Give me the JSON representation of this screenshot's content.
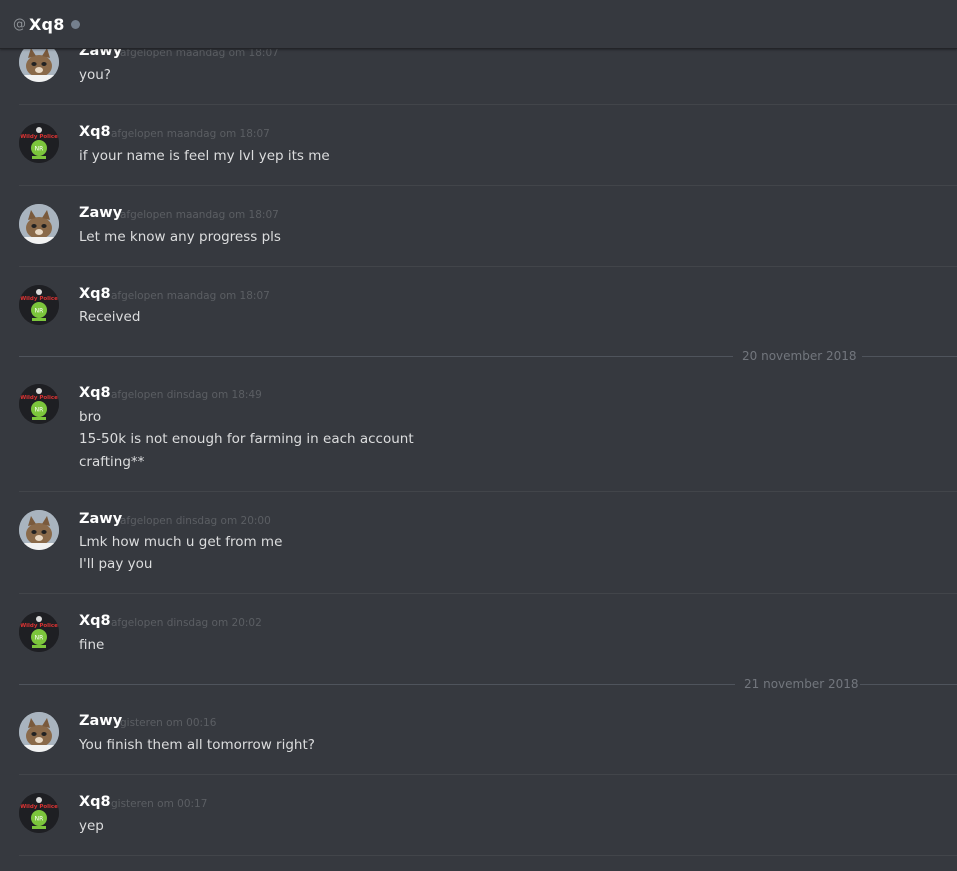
{
  "header": {
    "at_symbol": "@",
    "name": "Xq8"
  },
  "messages": [
    {
      "author": "Zawy",
      "time": "afgelopen maandag om 18:07",
      "lines": [
        "you?"
      ],
      "avatar": "cat-avatar"
    },
    {
      "author": "Xq8",
      "time": "afgelopen maandag om 18:07",
      "lines": [
        "if your name is feel my lvl yep its me"
      ],
      "avatar": "skull-badge-avatar"
    },
    {
      "author": "Zawy",
      "time": "afgelopen maandag om 18:07",
      "lines": [
        "Let me know any progress pls"
      ],
      "avatar": "cat-avatar"
    },
    {
      "author": "Xq8",
      "time": "afgelopen maandag om 18:07",
      "lines": [
        "Received"
      ],
      "avatar": "skull-badge-avatar"
    },
    {
      "author": "Xq8",
      "time": "afgelopen dinsdag om 18:49",
      "lines": [
        "bro",
        "15-50k is not enough for farming in each account",
        "crafting**"
      ],
      "avatar": "skull-badge-avatar"
    },
    {
      "author": "Zawy",
      "time": "afgelopen dinsdag om 20:00",
      "lines": [
        "Lmk how much u get from me",
        "I'll pay you"
      ],
      "avatar": "cat-avatar"
    },
    {
      "author": "Xq8",
      "time": "afgelopen dinsdag om 20:02",
      "lines": [
        "fine"
      ],
      "avatar": "skull-badge-avatar"
    },
    {
      "author": "Zawy",
      "time": "gisteren om 00:16",
      "lines": [
        "You finish them all tomorrow right?"
      ],
      "avatar": "cat-avatar"
    },
    {
      "author": "Xq8",
      "time": "gisteren om 00:17",
      "lines": [
        "yep"
      ],
      "avatar": "skull-badge-avatar"
    }
  ],
  "date_dividers": [
    "20 november 2018",
    "21 november 2018"
  ],
  "avatar_text": {
    "xq8_top": "Wildy Police",
    "xq8_badge": "NR"
  },
  "colors": {
    "background": "#36393f",
    "username": "#ffffff",
    "timestamp": "#5b5e63",
    "message_text": "#dcddde",
    "status_offline": "#747f8d"
  }
}
